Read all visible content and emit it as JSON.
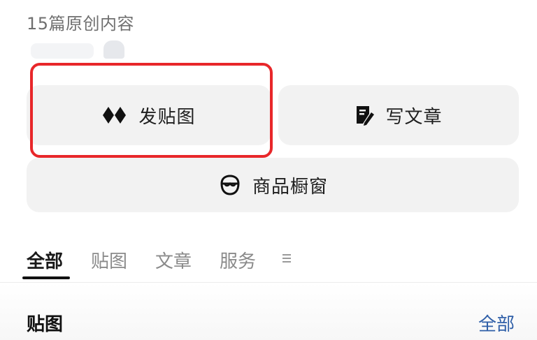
{
  "profile": {
    "original_count_text": "15篇原创内容"
  },
  "actions": {
    "post_image": {
      "label": "发贴图",
      "icon": "diamond-pair-icon"
    },
    "write_article": {
      "label": "写文章",
      "icon": "note-pen-icon"
    },
    "shop_window": {
      "label": "商品橱窗",
      "icon": "shop-face-icon"
    }
  },
  "annotation": {
    "highlight_color": "#e8272a"
  },
  "tabs": {
    "items": [
      "全部",
      "贴图",
      "文章",
      "服务"
    ],
    "active_index": 0,
    "more_icon": "menu-lines-icon"
  },
  "section": {
    "title": "贴图",
    "all_link": "全部",
    "link_color": "#2f5fa8"
  }
}
